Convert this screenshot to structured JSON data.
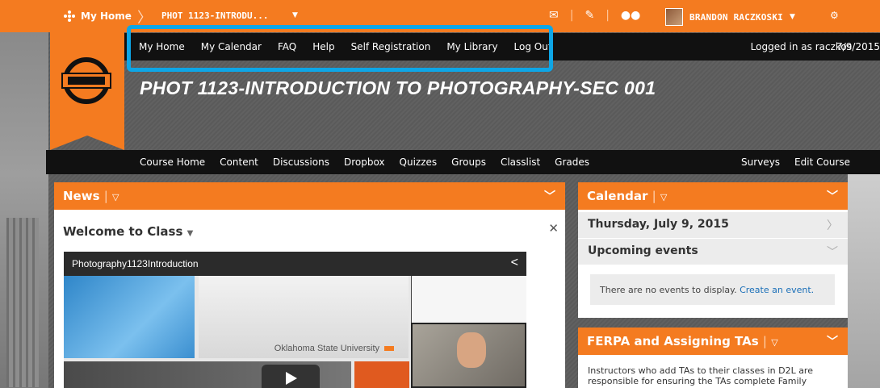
{
  "minibar": {
    "home_label": "My Home",
    "course_selector": "PHOT 1123-INTRODU...",
    "user_name": "BRANDON RACZKOSKI",
    "colors": {
      "accent": "#f47b20"
    }
  },
  "linkbar": {
    "links": [
      "My Home",
      "My Calendar",
      "FAQ",
      "Help",
      "Self Registration",
      "My Library",
      "Log Out"
    ],
    "logged_in": "Logged in as raczkos",
    "date": "7/9/2015"
  },
  "course_title": "PHOT 1123-INTRODUCTION TO PHOTOGRAPHY-SEC 001",
  "navbar": {
    "items": [
      "Course Home",
      "Content",
      "Discussions",
      "Dropbox",
      "Quizzes",
      "Groups",
      "Classlist",
      "Grades"
    ],
    "right_items": [
      "Surveys",
      "Edit Course"
    ]
  },
  "news": {
    "title": "News",
    "item_title": "Welcome to Class",
    "video_title": "Photography1123Introduction",
    "video_caption": "Oklahoma State University"
  },
  "calendar": {
    "title": "Calendar",
    "date": "Thursday, July 9, 2015",
    "upcoming": "Upcoming events",
    "no_events": "There are no events to display.",
    "create_link": "Create an event."
  },
  "ferpa": {
    "title": "FERPA and Assigning TAs",
    "text": "Instructors who add TAs to their classes in D2L are responsible for ensuring the TAs complete Family"
  }
}
